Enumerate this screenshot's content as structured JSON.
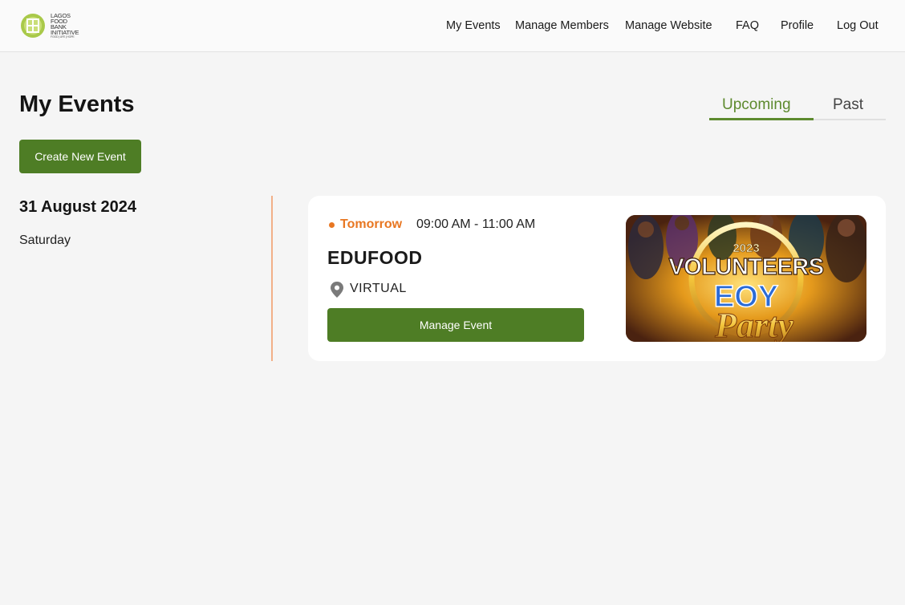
{
  "brand": {
    "name_lines": [
      "LAGOS",
      "FOOD",
      "BANK",
      "INITIATIVE"
    ],
    "tagline": "FOOD | LIFE | HOPE",
    "accent": "#4e7d25",
    "highlight": "#e87722"
  },
  "nav": {
    "items": [
      {
        "label": "My Events"
      },
      {
        "label": "Manage Members"
      },
      {
        "label": "Manage Website"
      },
      {
        "label": "FAQ"
      },
      {
        "label": "Profile"
      },
      {
        "label": "Log Out"
      }
    ]
  },
  "page": {
    "title": "My Events",
    "create_button": "Create New Event"
  },
  "tabs": {
    "items": [
      {
        "label": "Upcoming",
        "active": true
      },
      {
        "label": "Past",
        "active": false
      }
    ]
  },
  "events": {
    "groups": [
      {
        "date": "31 August 2024",
        "weekday": "Saturday",
        "items": [
          {
            "status": "Tomorrow",
            "time": "09:00 AM - 11:00 AM",
            "name": "EDUFOOD",
            "location": "VIRTUAL",
            "manage_label": "Manage Event",
            "image": {
              "year_text": "2023",
              "line1": "VOLUNTEERS",
              "line2": "EOY",
              "line3": "Party"
            }
          }
        ]
      }
    ]
  },
  "icons": {
    "location": "map-pin-icon",
    "logo": "lfbi-logo-icon"
  }
}
